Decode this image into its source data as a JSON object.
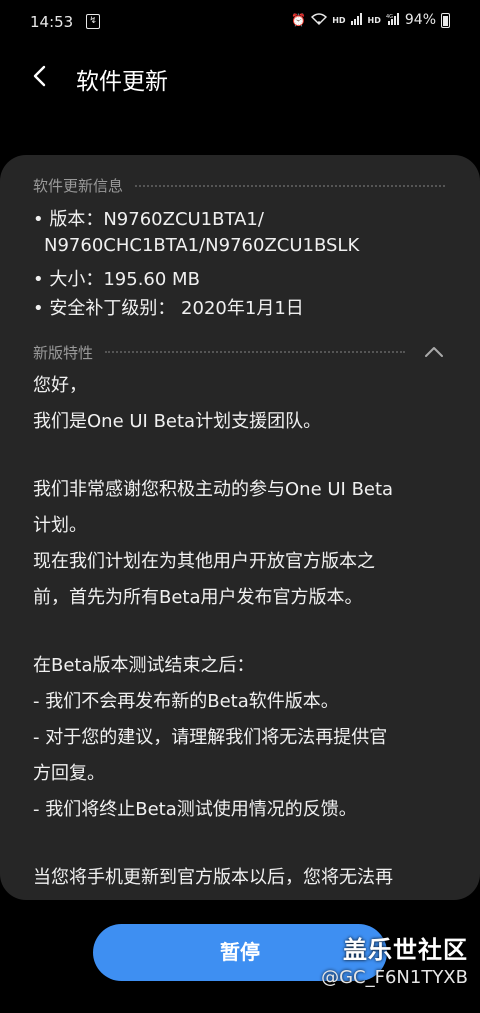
{
  "status_bar": {
    "time": "14:53",
    "notif_icon": "sim-notification-icon",
    "battery": "94%"
  },
  "header": {
    "title": "软件更新"
  },
  "info_section": {
    "label": "软件更新信息",
    "version_line1": "• 版本：N9760ZCU1BTA1/",
    "version_line2": "N9760CHC1BTA1/N9760ZCU1BSLK",
    "size": "• 大小：195.60 MB",
    "security": "• 安全补丁级别：  2020年1月1日"
  },
  "features_section": {
    "label": "新版特性",
    "lines": [
      "您好，",
      "我们是One UI Beta计划支援团队。",
      "",
      "我们非常感谢您积极主动的参与One UI Beta",
      "计划。",
      "现在我们计划在为其他用户开放官方版本之",
      "前，首先为所有Beta用户发布官方版本。",
      "",
      "在Beta版本测试结束之后：",
      "- 我们不会再发布新的Beta软件版本。",
      "- 对于您的建议，请理解我们将无法再提供官",
      "方回复。",
      "- 我们将终止Beta测试使用情况的反馈。",
      "",
      "当您将手机更新到官方版本以后，您将无法再"
    ]
  },
  "footer": {
    "pause_label": "暂停"
  },
  "watermark": {
    "title": "盖乐世社区",
    "user": "@GC_F6N1TYXB"
  },
  "colors": {
    "background": "#000000",
    "card": "#262626",
    "accent": "#3e8ff2",
    "muted": "#9a9a9a"
  }
}
